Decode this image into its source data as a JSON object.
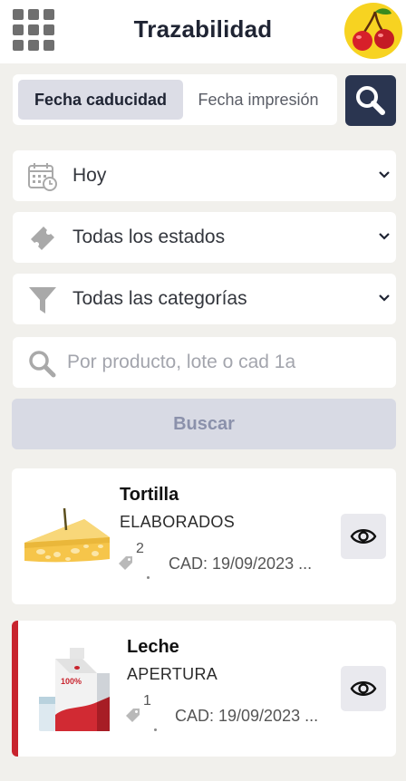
{
  "header": {
    "title": "Trazabilidad",
    "menu_icon": "grid-menu-icon",
    "avatar_icon": "cherries-icon"
  },
  "date_toggle": {
    "options": [
      "Fecha caducidad",
      "Fecha impresión"
    ],
    "selected": "Fecha caducidad"
  },
  "filters": {
    "date": {
      "icon": "calendar-clock-icon",
      "value": "Hoy"
    },
    "status": {
      "icon": "ticket-icon",
      "value": "Todas los estados"
    },
    "category": {
      "icon": "filter-funnel-icon",
      "value": "Todas las categorías"
    }
  },
  "search": {
    "placeholder": "Por producto, lote o cad 1a",
    "value": "",
    "button_label": "Buscar"
  },
  "results": [
    {
      "name": "Tortilla",
      "category": "ELABORADOS",
      "label_count": "2",
      "cad": "CAD: 19/09/2023 ...",
      "image_icon": "cheese-wedge-icon",
      "highlight": false
    },
    {
      "name": "Leche",
      "category": "APERTURA",
      "label_count": "1",
      "cad": "CAD: 19/09/2023 ...",
      "image_icon": "milk-carton-icon",
      "image_text": "100%",
      "highlight": true
    }
  ],
  "colors": {
    "accent_dark": "#2a3550",
    "background": "#f1f0ec",
    "alert_stripe": "#c8242e",
    "avatar_bg": "#f7d321"
  }
}
